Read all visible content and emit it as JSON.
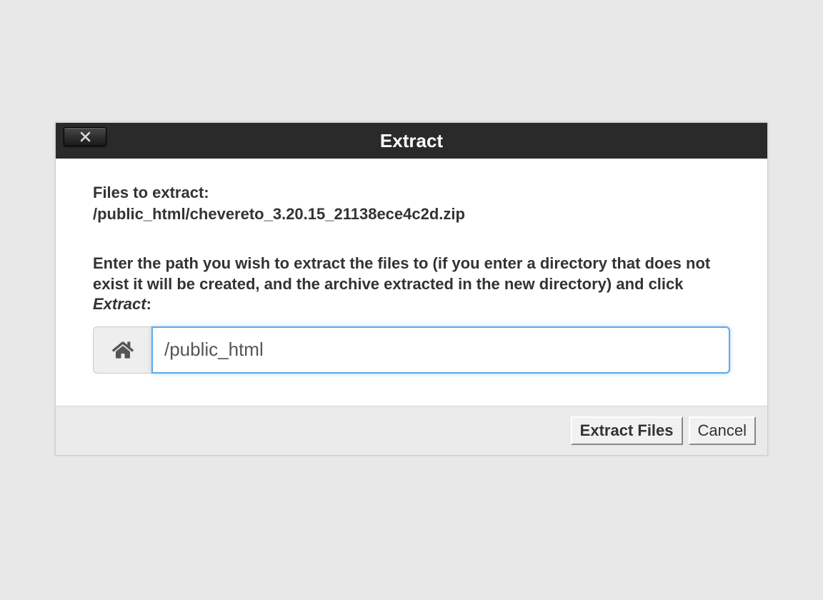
{
  "dialog": {
    "title": "Extract",
    "files_label": "Files to extract:",
    "file_path": "/public_html/chevereto_3.20.15_21138ece4c2d.zip",
    "instruction_prefix": "Enter the path you wish to extract the files to (if you enter a directory that does not exist it will be created, and the archive extracted in the new directory) and click ",
    "instruction_emphasis": "Extract",
    "instruction_suffix": ":",
    "input_value": "/public_html",
    "buttons": {
      "extract": "Extract Files",
      "cancel": "Cancel"
    }
  }
}
